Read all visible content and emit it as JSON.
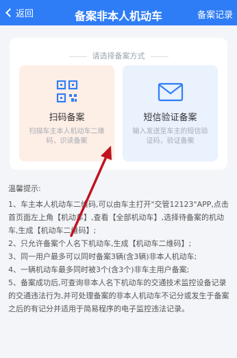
{
  "header": {
    "back_label": "返回",
    "title": "备案非本人机动车",
    "records_label": "备案记录",
    "bar_color": "#2f7df6"
  },
  "choose": {
    "label": "请选择备案方式",
    "options": [
      {
        "name": "扫码备案",
        "desc": "扫描车主本人机动车二维码，识读备案",
        "icon": "qrcode-icon"
      },
      {
        "name": "短信验证备案",
        "desc": "输入发送至车主的短信验证码，验证备案",
        "icon": "envelope-icon"
      }
    ]
  },
  "tips": {
    "title": "温馨提示:",
    "items": [
      "1、车主本人机动车二维码,可以由车主打开\"交管12123\"APP,点击首页面左上角【机动车】,查看【全部机动车】,选择待备案的机动车,生成【机动车二维码】;",
      "2、只允许备案个人名下机动车,生成【机动车二维码】;",
      "3、同一用户最多可以同时备案3辆(含3辆)非本人机动车;",
      "4、一辆机动车最多同时被3个(含3个)非车主用户备案;",
      "5、备案成功后,可查询非本人名下机动车的交通技术监控设备记录的交通违法行为,并可处理备案的非本人机动车不记分或发生于备案之后的有记分并适用于简易程序的电子监控违法记录。"
    ]
  }
}
